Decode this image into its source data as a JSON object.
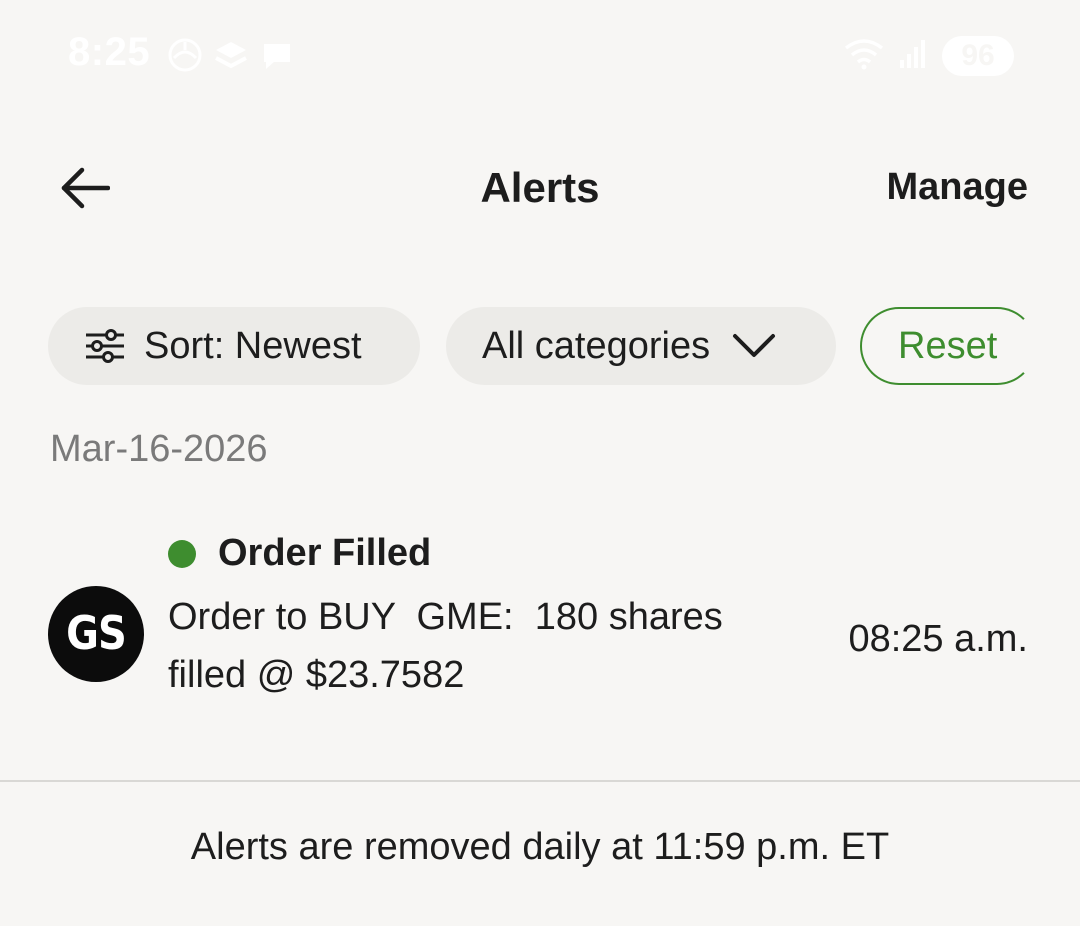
{
  "status_bar": {
    "time": "8:25",
    "battery": "96",
    "icons_left": [
      "sun-icon",
      "stack-icon",
      "chat-icon"
    ],
    "icons_right": [
      "wifi-icon",
      "signal-icon"
    ]
  },
  "header": {
    "title": "Alerts",
    "manage_label": "Manage"
  },
  "filters": {
    "sort_label": "Sort: Newest",
    "category_label": "All categories",
    "reset_label": "Reset"
  },
  "date_group": "Mar-16-2026",
  "alerts": [
    {
      "avatar": "GS",
      "title": "Order Filled",
      "body": "Order to BUY  GME:  180 shares\nfilled @ $23.7582",
      "time": "08:25 a.m.",
      "status_color": "#3e8d2f"
    }
  ],
  "footer_note": "Alerts are removed daily at 11:59 p.m. ET",
  "colors": {
    "accent_green": "#3e8d2f",
    "background": "#f7f6f4",
    "chip_bg": "#ecebe8",
    "text": "#1d1d1d",
    "muted": "#7a7a7a"
  }
}
